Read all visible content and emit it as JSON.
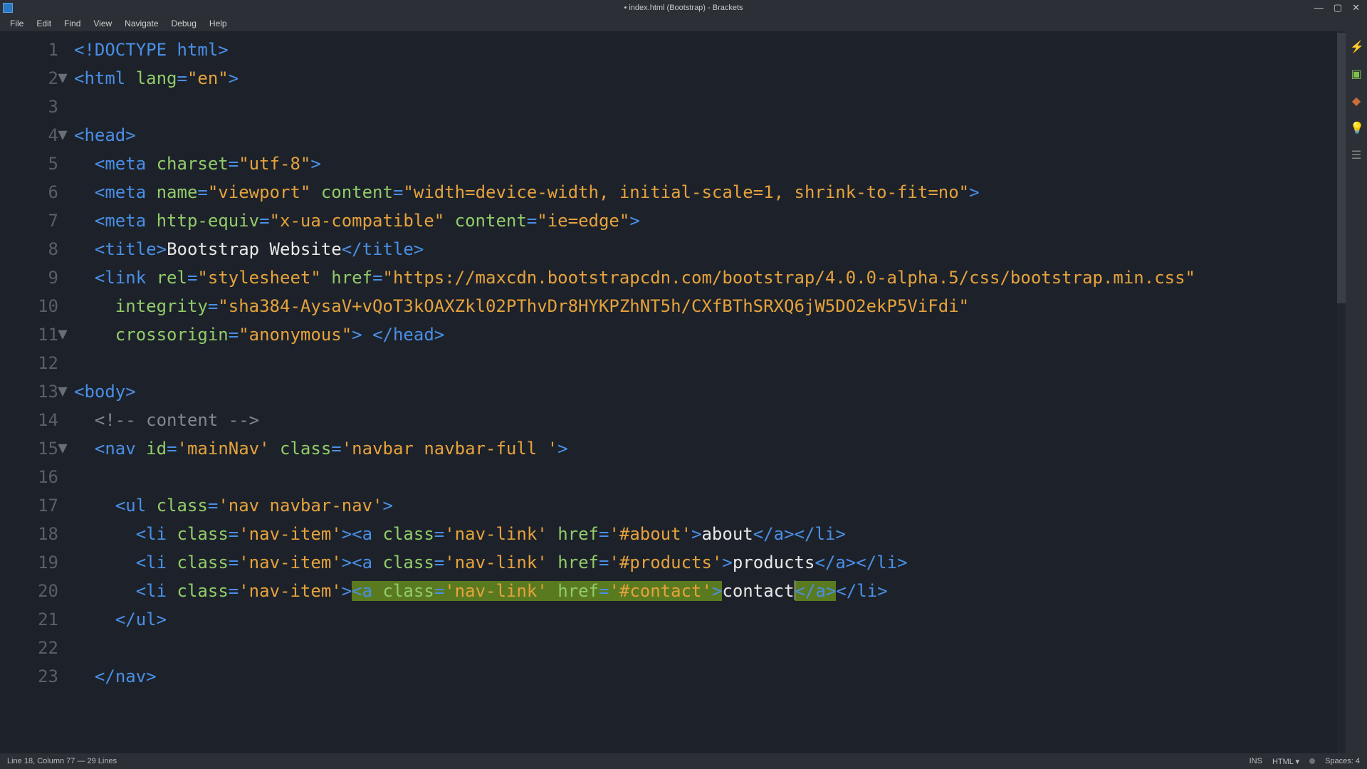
{
  "window": {
    "title": "• index.html (Bootstrap) - Brackets"
  },
  "menu": {
    "items": [
      "File",
      "Edit",
      "Find",
      "View",
      "Navigate",
      "Debug",
      "Help"
    ]
  },
  "gutter": {
    "lines": [
      "1",
      "2",
      "3",
      "4",
      "5",
      "6",
      "7",
      "8",
      "9",
      "10",
      "11",
      "12",
      "13",
      "14",
      "15",
      "16",
      "17",
      "18",
      "19",
      "20",
      "21",
      "22",
      "23"
    ],
    "folds": {
      "2": "▼",
      "4": "▼",
      "11": "▼",
      "13": "▼",
      "15": "▼"
    }
  },
  "code": {
    "l1": {
      "a": "<!DOCTYPE html>"
    },
    "l2": {
      "a": "<",
      "b": "html ",
      "c": "lang",
      "d": "=",
      "e": "\"en\"",
      "f": ">"
    },
    "l4": {
      "a": "<",
      "b": "head",
      "c": ">"
    },
    "l5": {
      "a": "<",
      "b": "meta ",
      "c": "charset",
      "d": "=",
      "e": "\"utf-8\"",
      "f": ">"
    },
    "l6": {
      "a": "<",
      "b": "meta ",
      "c": "name",
      "d": "=",
      "e": "\"viewport\" ",
      "f": "content",
      "g": "=",
      "h": "\"width=device-width, initial-scale=1, shrink-to-fit=no\"",
      "i": ">"
    },
    "l7": {
      "a": "<",
      "b": "meta ",
      "c": "http-equiv",
      "d": "=",
      "e": "\"x-ua-compatible\" ",
      "f": "content",
      "g": "=",
      "h": "\"ie=edge\"",
      "i": ">"
    },
    "l8": {
      "a": "<",
      "b": "title",
      "c": ">",
      "d": "Bootstrap Website",
      "e": "</",
      "f": "title",
      "g": ">"
    },
    "l9": {
      "a": "<",
      "b": "link ",
      "c": "rel",
      "d": "=",
      "e": "\"stylesheet\" ",
      "f": "href",
      "g": "=",
      "h": "\"https://maxcdn.bootstrapcdn.com/bootstrap/4.0.0-alpha.5/css/bootstrap.min.css\""
    },
    "l9b": {
      "a": "integrity",
      "b": "=",
      "c": "\"sha384-AysaV+vQoT3kOAXZkl02PThvDr8HYKPZhNT5h/CXfBThSRXQ6jW5DO2ekP5ViFdi\""
    },
    "l9c": {
      "a": "crossorigin",
      "b": "=",
      "c": "\"anonymous\"",
      "d": "> ",
      "e": "</",
      "f": "head",
      "g": ">"
    },
    "l11": {
      "a": "<",
      "b": "body",
      "c": ">"
    },
    "l12": {
      "a": "<!-- content -->"
    },
    "l13": {
      "a": "<",
      "b": "nav ",
      "c": "id",
      "d": "=",
      "e": "'mainNav' ",
      "f": "class",
      "g": "=",
      "h": "'navbar navbar-full '",
      "i": ">"
    },
    "l15": {
      "a": "<",
      "b": "ul ",
      "c": "class",
      "d": "=",
      "e": "'nav navbar-nav'",
      "f": ">"
    },
    "l16": {
      "a": "<",
      "b": "li ",
      "c": "class",
      "d": "=",
      "e": "'nav-item'",
      "f": "><",
      "g": "a ",
      "h": "class",
      "i": "=",
      "j": "'nav-link' ",
      "k": "href",
      "l": "=",
      "m": "'#about'",
      "n": ">",
      "o": "about",
      "p": "</",
      "q": "a",
      "r": "></",
      "s": "li",
      "t": ">"
    },
    "l17": {
      "a": "<",
      "b": "li ",
      "c": "class",
      "d": "=",
      "e": "'nav-item'",
      "f": "><",
      "g": "a ",
      "h": "class",
      "i": "=",
      "j": "'nav-link' ",
      "k": "href",
      "l": "=",
      "m": "'#products'",
      "n": ">",
      "o": "products",
      "p": "</",
      "q": "a",
      "r": "></",
      "s": "li",
      "t": ">"
    },
    "l18": {
      "a": "<",
      "b": "li ",
      "c": "class",
      "d": "=",
      "e": "'nav-item'",
      "f": ">",
      "g": "<",
      "h": "a ",
      "i": "class",
      "j": "=",
      "k": "'nav-link' ",
      "l": "href",
      "m": "=",
      "n": "'#contact'",
      "o": ">",
      "p": "contact",
      "q": "</",
      "r": "a",
      "s": ">",
      "t": "</",
      "u": "li",
      "v": ">"
    },
    "l19": {
      "a": "</",
      "b": "ul",
      "c": ">"
    },
    "l21": {
      "a": "</",
      "b": "nav",
      "c": ">"
    }
  },
  "statusbar": {
    "cursor": "Line 18, Column 77 — 29 Lines",
    "ins": "INS",
    "lang": "HTML ▾",
    "spaces": "Spaces: 4"
  }
}
